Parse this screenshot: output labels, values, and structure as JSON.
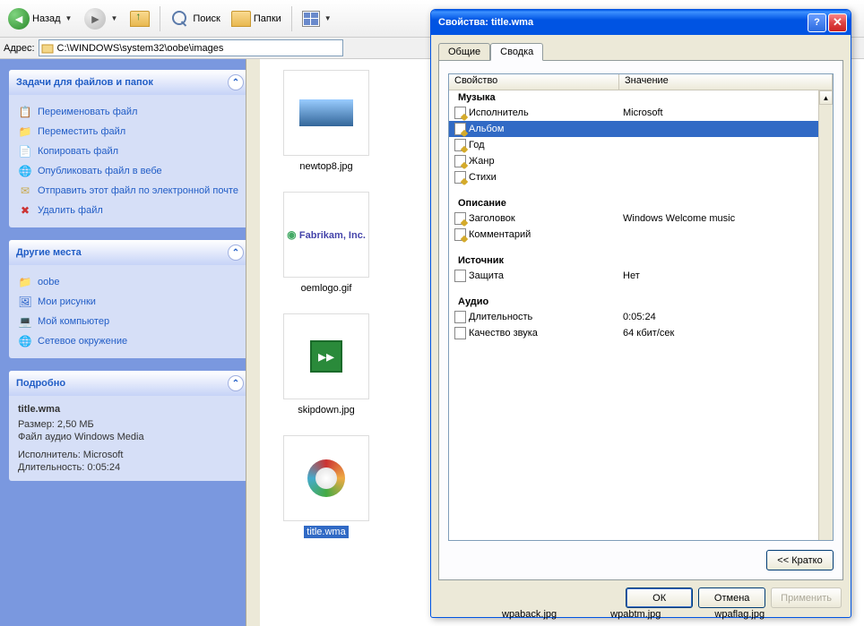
{
  "toolbar": {
    "back": "Назад",
    "search": "Поиск",
    "folders": "Папки"
  },
  "address": {
    "label": "Адрес:",
    "value": "C:\\WINDOWS\\system32\\oobe\\images"
  },
  "panels": {
    "tasks": {
      "title": "Задачи для файлов и папок",
      "items": [
        "Переименовать файл",
        "Переместить файл",
        "Копировать файл",
        "Опубликовать файл в вебе",
        "Отправить этот файл по электронной почте",
        "Удалить файл"
      ]
    },
    "places": {
      "title": "Другие места",
      "items": [
        "oobe",
        "Мои рисунки",
        "Мой компьютер",
        "Сетевое окружение"
      ]
    },
    "details": {
      "title": "Подробно",
      "filename": "title.wma",
      "size": "Размер: 2,50 МБ",
      "type": "Файл аудио Windows Media",
      "artist": "Исполнитель: Microsoft",
      "duration": "Длительность: 0:05:24"
    }
  },
  "files": [
    {
      "name": "newtop8.jpg"
    },
    {
      "name": "oemlogo.gif"
    },
    {
      "name": "skipdown.jpg"
    },
    {
      "name": "title.wma"
    },
    {
      "name": "wpaback.jpg"
    },
    {
      "name": "wpabtm.jpg"
    },
    {
      "name": "wpaflag.jpg"
    }
  ],
  "fabrikam_text": "Fabrikam, Inc.",
  "dialog": {
    "title": "Свойства: title.wma",
    "tabs": [
      "Общие",
      "Сводка"
    ],
    "columns": [
      "Свойство",
      "Значение"
    ],
    "groups": [
      {
        "name": "Музыка",
        "rows": [
          {
            "prop": "Исполнитель",
            "val": "Microsoft",
            "edit": true
          },
          {
            "prop": "Альбом",
            "val": "",
            "edit": true,
            "selected": true
          },
          {
            "prop": "Год",
            "val": "",
            "edit": true
          },
          {
            "prop": "Жанр",
            "val": "",
            "edit": true
          },
          {
            "prop": "Стихи",
            "val": "",
            "edit": true
          }
        ]
      },
      {
        "name": "Описание",
        "rows": [
          {
            "prop": "Заголовок",
            "val": "Windows Welcome music",
            "edit": true
          },
          {
            "prop": "Комментарий",
            "val": "",
            "edit": true
          }
        ]
      },
      {
        "name": "Источник",
        "rows": [
          {
            "prop": "Защита",
            "val": "Нет",
            "edit": false
          }
        ]
      },
      {
        "name": "Аудио",
        "rows": [
          {
            "prop": "Длительность",
            "val": "0:05:24",
            "edit": false
          },
          {
            "prop": "Качество звука",
            "val": "64 кбит/сек",
            "edit": false
          }
        ]
      }
    ],
    "brief_btn": "<< Кратко",
    "ok": "ОК",
    "cancel": "Отмена",
    "apply": "Применить"
  }
}
